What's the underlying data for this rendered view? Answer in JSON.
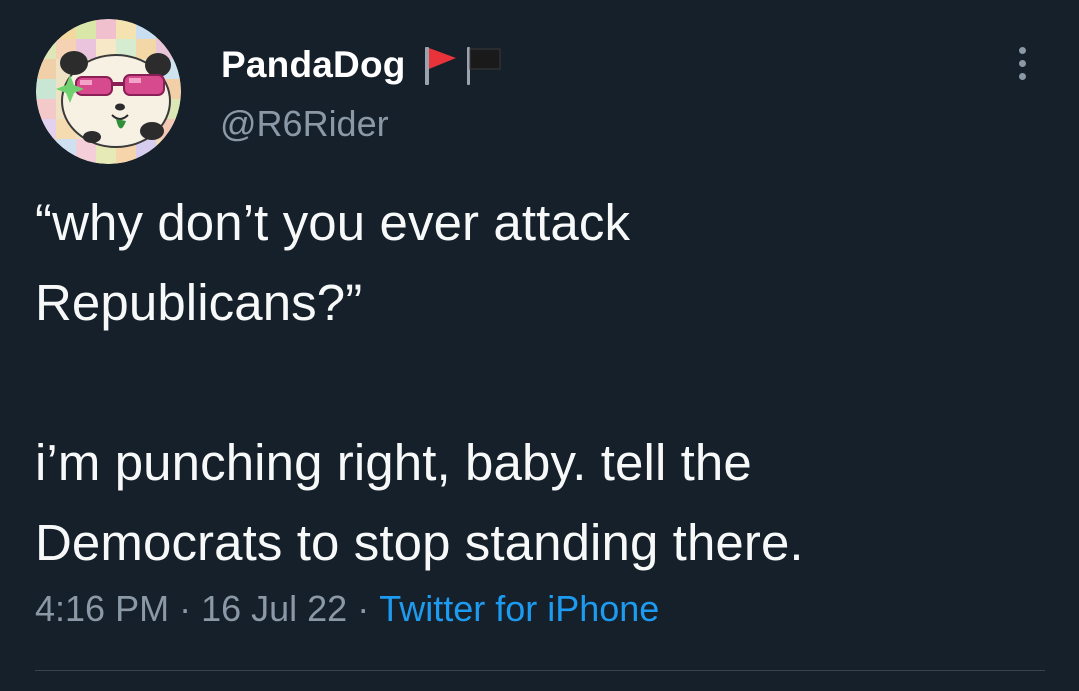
{
  "tweet": {
    "display_name": "PandaDog",
    "handle": "@R6Rider",
    "name_emoji": "red-flag and black-flag emoji",
    "text_line1": "“why don’t you ever attack",
    "text_line2": "Republicans?”",
    "text_line3": "i’m punching right, baby. tell the",
    "text_line4": "Democrats to stop standing there.",
    "time": "4:16 PM",
    "date": "16 Jul 22",
    "separator": "·",
    "source": "Twitter for iPhone"
  },
  "colors": {
    "background": "#15202b",
    "text": "#f7f9f9",
    "secondary_text": "#8b98a5",
    "link": "#1d9bf0",
    "red_flag": "#e8333a",
    "black_flag": "#1a1a1a"
  },
  "icons": {
    "avatar": "panda-dog-avatar",
    "flags": "red-flag-black-flag-icon",
    "more": "more-options-icon"
  }
}
